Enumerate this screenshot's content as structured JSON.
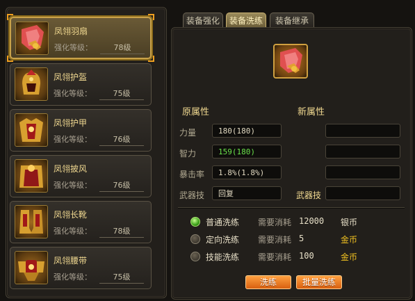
{
  "items": [
    {
      "name": "凤翎羽扇",
      "level_label": "强化等级：",
      "level": "78级",
      "icon": "fan-icon"
    },
    {
      "name": "凤翎护盔",
      "level_label": "强化等级：",
      "level": "75级",
      "icon": "helmet-icon"
    },
    {
      "name": "凤翎护甲",
      "level_label": "强化等级：",
      "level": "76级",
      "icon": "armor-icon"
    },
    {
      "name": "凤翎披风",
      "level_label": "强化等级：",
      "level": "76级",
      "icon": "cape-icon"
    },
    {
      "name": "凤翎长靴",
      "level_label": "强化等级：",
      "level": "78级",
      "icon": "boots-icon"
    },
    {
      "name": "凤翎腰带",
      "level_label": "强化等级：",
      "level": "75级",
      "icon": "belt-icon"
    }
  ],
  "tabs": [
    {
      "label": "装备强化"
    },
    {
      "label": "装备洗练"
    },
    {
      "label": "装备继承"
    }
  ],
  "active_tab": 1,
  "original_title": "原属性",
  "new_title": "新属性",
  "attributes": [
    {
      "label": "力量",
      "value": "180(180)",
      "color": "#e0d8c0"
    },
    {
      "label": "智力",
      "value": "159(180)",
      "color": "#6ae04a"
    },
    {
      "label": "暴击率",
      "value": "1.8%(1.8%)",
      "color": "#e0d8c0"
    },
    {
      "label": "武器技",
      "value": "回复",
      "color": "#e0d8c0"
    }
  ],
  "new_weapon_skill_label": "武器技",
  "options": [
    {
      "label": "普通洗练",
      "cost_label": "需要消耗",
      "cost": "12000",
      "currency": "银币",
      "currency_color": "#e8e0c8",
      "checked": true
    },
    {
      "label": "定向洗练",
      "cost_label": "需要消耗",
      "cost": "5",
      "currency": "金币",
      "currency_color": "#f0c020",
      "checked": false
    },
    {
      "label": "技能洗练",
      "cost_label": "需要消耗",
      "cost": "100",
      "currency": "金币",
      "currency_color": "#f0c020",
      "checked": false
    }
  ],
  "buttons": {
    "refine": "洗练",
    "batch_refine": "批量洗练"
  },
  "colors": {
    "accent": "#f0a020",
    "gold_text": "#f0d890",
    "green_text": "#6ae04a"
  }
}
